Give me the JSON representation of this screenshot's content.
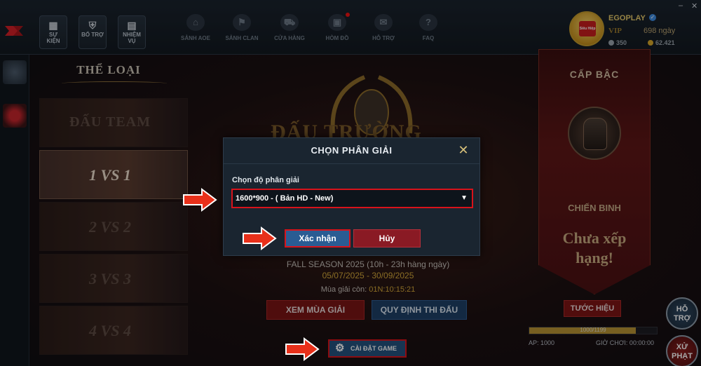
{
  "quick_menu": [
    {
      "label_line1": "SỰ",
      "label_line2": "KIỆN",
      "icon": "calendar-icon"
    },
    {
      "label_line1": "BỔ TRỢ",
      "label_line2": "",
      "icon": "shield-icon"
    },
    {
      "label_line1": "NHIỆM",
      "label_line2": "VỤ",
      "icon": "clipboard-icon"
    }
  ],
  "nav": [
    {
      "label": "SẢNH AOE",
      "icon": "home-icon"
    },
    {
      "label": "SẢNH CLAN",
      "icon": "flag-icon"
    },
    {
      "label": "CỬA HÀNG",
      "icon": "cart-icon"
    },
    {
      "label": "HÒM ĐỒ",
      "icon": "chest-icon",
      "badge": true
    },
    {
      "label": "HỖ TRỢ",
      "icon": "messenger-icon"
    },
    {
      "label": "FAQ",
      "icon": "faq-icon"
    }
  ],
  "profile": {
    "name": "EGOPLAY",
    "vip_label": "VIP",
    "vip_days": "698 ngày",
    "silver": "350",
    "gold": "62.421",
    "avatar_text": "Siêu Hiệp"
  },
  "window": {
    "minimize": "–",
    "close": "✕"
  },
  "mode_panel": {
    "title": "THỂ LOẠI",
    "modes": [
      {
        "label": "ĐẤU TEAM",
        "active": false
      },
      {
        "label": "1 VS 1",
        "active": true
      },
      {
        "label": "2 VS 2",
        "active": false
      },
      {
        "label": "3 VS 3",
        "active": false
      },
      {
        "label": "4 VS 4",
        "active": false
      }
    ]
  },
  "season": {
    "art_title": "ĐẤU TRƯỜNG",
    "name": "FALL SEASON 2025 (10h - 23h hàng ngày)",
    "dates": "05/07/2025 - 30/09/2025",
    "remaining_label": "Mùa giải còn:",
    "remaining_value": "01N:10:15:21",
    "btn_view_season": "XEM MÙA GIẢI",
    "btn_rules": "QUY ĐỊNH THI ĐẤU",
    "btn_settings": "CÀI ĐẶT GAME"
  },
  "rank": {
    "title": "CẤP BẬC",
    "name": "CHIẾN BINH",
    "status_line1": "Chưa xếp",
    "status_line2": "hạng!",
    "btn_title": "TƯỚC HIỆU",
    "progress_text": "1000/1199",
    "progress_fraction": 0.834,
    "ap": "AP: 1000",
    "game_time": "GIỜ CHƠI: 00:00:00"
  },
  "float_buttons": {
    "help_line1": "HỖ",
    "help_line2": "TRỢ",
    "penalty_line1": "XỬ",
    "penalty_line2": "PHẠT"
  },
  "modal": {
    "title": "CHỌN PHÂN GIẢI",
    "close": "✕",
    "field_label": "Chọn độ phân giải",
    "selected_option": "1600*900 - ( Bản HD - New)",
    "btn_confirm": "Xác nhận",
    "btn_cancel": "Hủy"
  },
  "colors": {
    "highlight_red": "#d8131b",
    "accent_gold": "#d4a83a",
    "confirm_blue": "#2a5c93",
    "cancel_red": "#8a1a24"
  }
}
